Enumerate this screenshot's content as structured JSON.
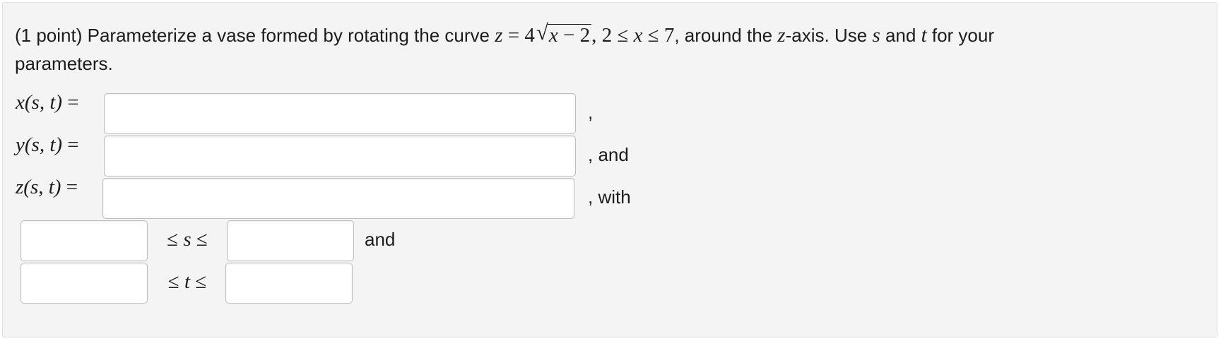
{
  "problem": {
    "points": "(1 point)",
    "text_a": " Parameterize a vase formed by rotating the curve ",
    "curve_lhs": "z",
    "curve_eq": " = 4",
    "radicand_var": "x",
    "radicand_rest": " − 2",
    "curve_range_a": ", 2 ≤ ",
    "curve_range_var": "x",
    "curve_range_b": " ≤ 7",
    "text_b": ", around the ",
    "axis_var": "z",
    "text_c": "-axis. Use ",
    "param_s": "s",
    "text_d": " and ",
    "param_t": "t",
    "text_e": " for your",
    "line2": "parameters."
  },
  "equations": [
    {
      "func": "x",
      "args": "(s, t)",
      "equals": " =",
      "trailing": ","
    },
    {
      "func": "y",
      "args": "(s, t)",
      "equals": " =",
      "trailing": ", and"
    },
    {
      "func": "z",
      "args": "(s, t)",
      "equals": " =",
      "trailing": ", with"
    }
  ],
  "bounds": [
    {
      "relation_left": "≤ ",
      "var": "s",
      "relation_right": " ≤",
      "trailing": "and"
    },
    {
      "relation_left": "≤ ",
      "var": "t",
      "relation_right": " ≤",
      "trailing": ""
    }
  ],
  "inputs": {
    "x_value": "",
    "y_value": "",
    "z_value": "",
    "s_lower": "",
    "s_upper": "",
    "t_lower": "",
    "t_upper": ""
  }
}
